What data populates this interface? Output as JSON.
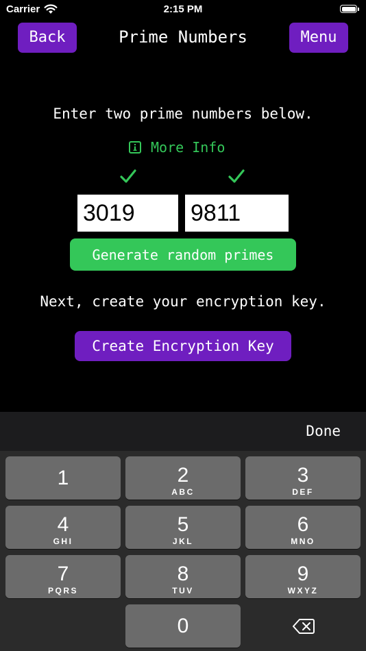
{
  "status_bar": {
    "carrier": "Carrier",
    "time": "2:15 PM"
  },
  "nav": {
    "back_label": "Back",
    "title": "Prime Numbers",
    "menu_label": "Menu"
  },
  "main": {
    "instruction_primes": "Enter two prime numbers below.",
    "more_info_label": "More Info",
    "prime_a": "3019",
    "prime_b": "9811",
    "generate_label": "Generate random primes",
    "instruction_key": "Next, create your encryption key.",
    "create_key_label": "Create Encryption Key"
  },
  "keyboard": {
    "done_label": "Done",
    "keys": [
      {
        "num": "1",
        "letters": ""
      },
      {
        "num": "2",
        "letters": "ABC"
      },
      {
        "num": "3",
        "letters": "DEF"
      },
      {
        "num": "4",
        "letters": "GHI"
      },
      {
        "num": "5",
        "letters": "JKL"
      },
      {
        "num": "6",
        "letters": "MNO"
      },
      {
        "num": "7",
        "letters": "PQRS"
      },
      {
        "num": "8",
        "letters": "TUV"
      },
      {
        "num": "9",
        "letters": "WXYZ"
      },
      {
        "num": "0",
        "letters": ""
      }
    ]
  },
  "icons": {
    "wifi": "wifi-icon",
    "battery": "battery-icon",
    "info": "info-icon",
    "check": "checkmark-icon",
    "delete": "backspace-icon"
  },
  "colors": {
    "accent_purple": "#6f1ec0",
    "accent_green": "#34c759",
    "background": "#000000"
  }
}
